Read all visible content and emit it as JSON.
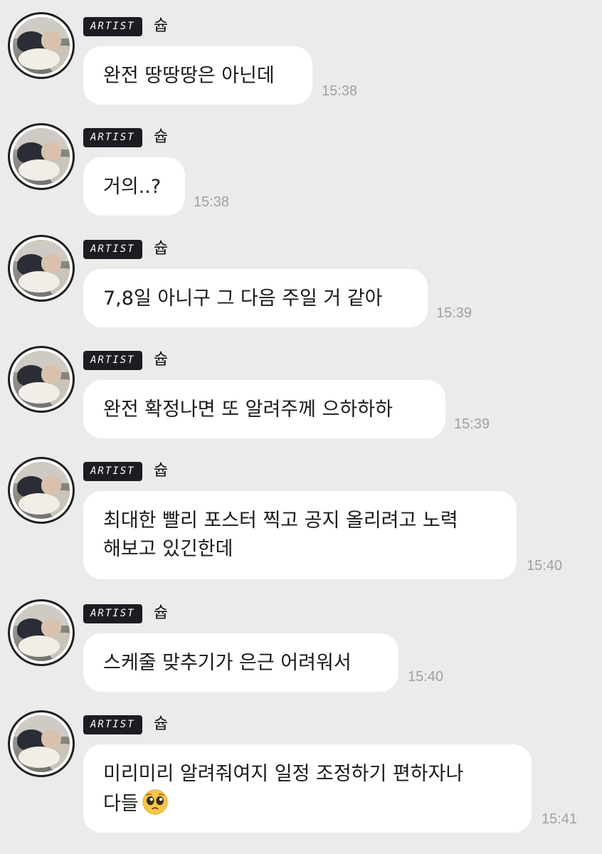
{
  "messages": [
    {
      "badge": "ARTIST",
      "sender": "슙",
      "lines": [
        "완전 땅땅땅은 아닌데"
      ],
      "time": "15:38"
    },
    {
      "badge": "ARTIST",
      "sender": "슙",
      "lines": [
        "거의..?"
      ],
      "time": "15:38"
    },
    {
      "badge": "ARTIST",
      "sender": "슙",
      "lines": [
        "7,8일 아니구 그 다음 주일 거 같아"
      ],
      "time": "15:39"
    },
    {
      "badge": "ARTIST",
      "sender": "슙",
      "lines": [
        "완전 확정나면 또 알려주께 으하하하"
      ],
      "time": "15:39"
    },
    {
      "badge": "ARTIST",
      "sender": "슙",
      "lines": [
        "최대한 빨리 포스터 찍고 공지 올리려고 노력",
        "해보고 있긴한데"
      ],
      "time": "15:40"
    },
    {
      "badge": "ARTIST",
      "sender": "슙",
      "lines": [
        "스케줄 맞추기가 은근 어려워서"
      ],
      "time": "15:40"
    },
    {
      "badge": "ARTIST",
      "sender": "슙",
      "lines": [
        "미리미리 알려줘여지 일정 조정하기 편하자나",
        "다들"
      ],
      "time": "15:41",
      "emoji": "pleading-face-icon"
    }
  ]
}
